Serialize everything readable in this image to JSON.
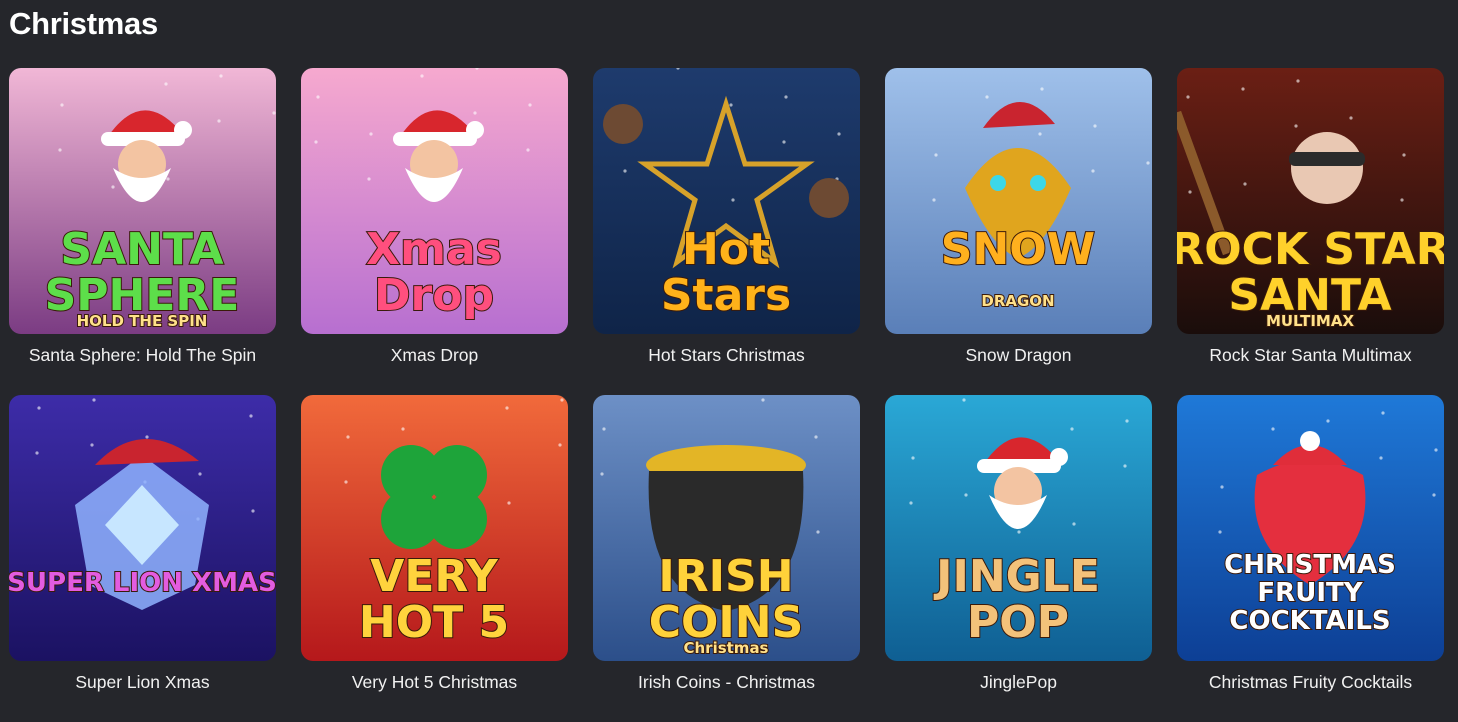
{
  "section": {
    "title": "Christmas"
  },
  "games": [
    {
      "name": "Santa Sphere: Hold The Spin",
      "art_lines": [
        "SANTA",
        "SPHERE"
      ],
      "art_sub": "HOLD THE SPIN",
      "icon": "santa-icon",
      "bg": [
        "#f1b7d6",
        "#7b3c83"
      ],
      "text_color": "#5dde4a"
    },
    {
      "name": "Xmas Drop",
      "art_lines": [
        "Xmas",
        "Drop"
      ],
      "art_sub": "",
      "icon": "santa-icon",
      "bg": [
        "#f6a9cf",
        "#b76fd0"
      ],
      "text_color": "#ff4f7e"
    },
    {
      "name": "Hot Stars Christmas",
      "art_lines": [
        "Hot",
        "Stars"
      ],
      "art_sub": "",
      "icon": "star-icon",
      "bg": [
        "#1e3b6d",
        "#0f2448"
      ],
      "text_color": "#ffb21a"
    },
    {
      "name": "Snow Dragon",
      "art_lines": [
        "SNOW"
      ],
      "art_sub": "DRAGON",
      "icon": "dragon-icon",
      "bg": [
        "#9fc0ea",
        "#5a7fb8"
      ],
      "text_color": "#ffb01e"
    },
    {
      "name": "Rock Star Santa Multimax",
      "art_lines": [
        "ROCK STAR",
        "SANTA"
      ],
      "art_sub": "MULTIMAX",
      "icon": "guitar-icon",
      "bg": [
        "#6b1f14",
        "#1a0d0b"
      ],
      "text_color": "#ffd12b"
    },
    {
      "name": "Super Lion Xmas",
      "art_lines": [
        "SUPER LION XMAS"
      ],
      "art_sub": "",
      "icon": "lion-icon",
      "bg": [
        "#3d2ca8",
        "#1b1262"
      ],
      "text_color": "#e35ce0"
    },
    {
      "name": "Very Hot 5 Christmas",
      "art_lines": [
        "VERY",
        "HOT 5"
      ],
      "art_sub": "",
      "icon": "clover-icon",
      "bg": [
        "#f16a3b",
        "#b5181b"
      ],
      "text_color": "#ffd33d"
    },
    {
      "name": "Irish Coins - Christmas",
      "art_lines": [
        "IRISH",
        "COINS"
      ],
      "art_sub": "Christmas",
      "icon": "pot-icon",
      "bg": [
        "#6d90c6",
        "#2c4f8a"
      ],
      "text_color": "#ffd23a"
    },
    {
      "name": "JinglePop",
      "art_lines": [
        "JINGLE",
        "POP"
      ],
      "art_sub": "",
      "icon": "santa-icon",
      "bg": [
        "#2aa8d6",
        "#0f5f93"
      ],
      "text_color": "#f3c27a"
    },
    {
      "name": "Christmas Fruity Cocktails",
      "art_lines": [
        "CHRISTMAS",
        "FRUITY",
        "COCKTAILS"
      ],
      "art_sub": "",
      "icon": "strawberry-icon",
      "bg": [
        "#1f79d8",
        "#0d3f95"
      ],
      "text_color": "#ffffff"
    }
  ]
}
